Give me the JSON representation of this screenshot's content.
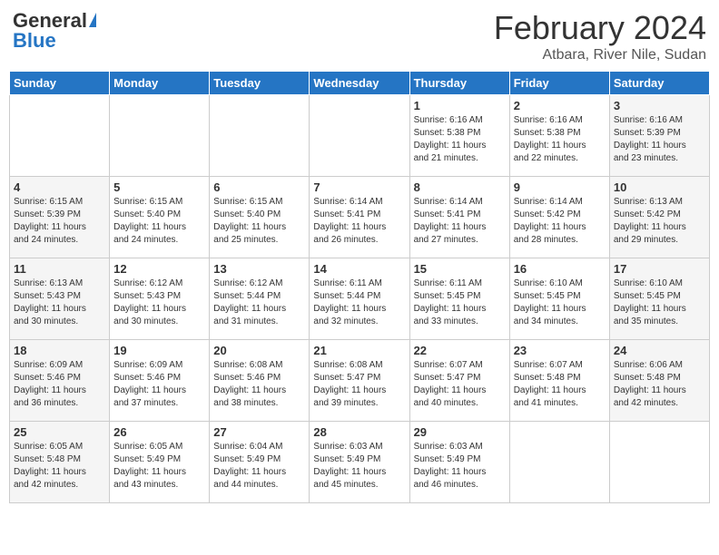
{
  "header": {
    "logo_general": "General",
    "logo_blue": "Blue",
    "month_title": "February 2024",
    "location": "Atbara, River Nile, Sudan"
  },
  "weekdays": [
    "Sunday",
    "Monday",
    "Tuesday",
    "Wednesday",
    "Thursday",
    "Friday",
    "Saturday"
  ],
  "weeks": [
    [
      {
        "day": "",
        "info": ""
      },
      {
        "day": "",
        "info": ""
      },
      {
        "day": "",
        "info": ""
      },
      {
        "day": "",
        "info": ""
      },
      {
        "day": "1",
        "info": "Sunrise: 6:16 AM\nSunset: 5:38 PM\nDaylight: 11 hours\nand 21 minutes."
      },
      {
        "day": "2",
        "info": "Sunrise: 6:16 AM\nSunset: 5:38 PM\nDaylight: 11 hours\nand 22 minutes."
      },
      {
        "day": "3",
        "info": "Sunrise: 6:16 AM\nSunset: 5:39 PM\nDaylight: 11 hours\nand 23 minutes."
      }
    ],
    [
      {
        "day": "4",
        "info": "Sunrise: 6:15 AM\nSunset: 5:39 PM\nDaylight: 11 hours\nand 24 minutes."
      },
      {
        "day": "5",
        "info": "Sunrise: 6:15 AM\nSunset: 5:40 PM\nDaylight: 11 hours\nand 24 minutes."
      },
      {
        "day": "6",
        "info": "Sunrise: 6:15 AM\nSunset: 5:40 PM\nDaylight: 11 hours\nand 25 minutes."
      },
      {
        "day": "7",
        "info": "Sunrise: 6:14 AM\nSunset: 5:41 PM\nDaylight: 11 hours\nand 26 minutes."
      },
      {
        "day": "8",
        "info": "Sunrise: 6:14 AM\nSunset: 5:41 PM\nDaylight: 11 hours\nand 27 minutes."
      },
      {
        "day": "9",
        "info": "Sunrise: 6:14 AM\nSunset: 5:42 PM\nDaylight: 11 hours\nand 28 minutes."
      },
      {
        "day": "10",
        "info": "Sunrise: 6:13 AM\nSunset: 5:42 PM\nDaylight: 11 hours\nand 29 minutes."
      }
    ],
    [
      {
        "day": "11",
        "info": "Sunrise: 6:13 AM\nSunset: 5:43 PM\nDaylight: 11 hours\nand 30 minutes."
      },
      {
        "day": "12",
        "info": "Sunrise: 6:12 AM\nSunset: 5:43 PM\nDaylight: 11 hours\nand 30 minutes."
      },
      {
        "day": "13",
        "info": "Sunrise: 6:12 AM\nSunset: 5:44 PM\nDaylight: 11 hours\nand 31 minutes."
      },
      {
        "day": "14",
        "info": "Sunrise: 6:11 AM\nSunset: 5:44 PM\nDaylight: 11 hours\nand 32 minutes."
      },
      {
        "day": "15",
        "info": "Sunrise: 6:11 AM\nSunset: 5:45 PM\nDaylight: 11 hours\nand 33 minutes."
      },
      {
        "day": "16",
        "info": "Sunrise: 6:10 AM\nSunset: 5:45 PM\nDaylight: 11 hours\nand 34 minutes."
      },
      {
        "day": "17",
        "info": "Sunrise: 6:10 AM\nSunset: 5:45 PM\nDaylight: 11 hours\nand 35 minutes."
      }
    ],
    [
      {
        "day": "18",
        "info": "Sunrise: 6:09 AM\nSunset: 5:46 PM\nDaylight: 11 hours\nand 36 minutes."
      },
      {
        "day": "19",
        "info": "Sunrise: 6:09 AM\nSunset: 5:46 PM\nDaylight: 11 hours\nand 37 minutes."
      },
      {
        "day": "20",
        "info": "Sunrise: 6:08 AM\nSunset: 5:46 PM\nDaylight: 11 hours\nand 38 minutes."
      },
      {
        "day": "21",
        "info": "Sunrise: 6:08 AM\nSunset: 5:47 PM\nDaylight: 11 hours\nand 39 minutes."
      },
      {
        "day": "22",
        "info": "Sunrise: 6:07 AM\nSunset: 5:47 PM\nDaylight: 11 hours\nand 40 minutes."
      },
      {
        "day": "23",
        "info": "Sunrise: 6:07 AM\nSunset: 5:48 PM\nDaylight: 11 hours\nand 41 minutes."
      },
      {
        "day": "24",
        "info": "Sunrise: 6:06 AM\nSunset: 5:48 PM\nDaylight: 11 hours\nand 42 minutes."
      }
    ],
    [
      {
        "day": "25",
        "info": "Sunrise: 6:05 AM\nSunset: 5:48 PM\nDaylight: 11 hours\nand 42 minutes."
      },
      {
        "day": "26",
        "info": "Sunrise: 6:05 AM\nSunset: 5:49 PM\nDaylight: 11 hours\nand 43 minutes."
      },
      {
        "day": "27",
        "info": "Sunrise: 6:04 AM\nSunset: 5:49 PM\nDaylight: 11 hours\nand 44 minutes."
      },
      {
        "day": "28",
        "info": "Sunrise: 6:03 AM\nSunset: 5:49 PM\nDaylight: 11 hours\nand 45 minutes."
      },
      {
        "day": "29",
        "info": "Sunrise: 6:03 AM\nSunset: 5:49 PM\nDaylight: 11 hours\nand 46 minutes."
      },
      {
        "day": "",
        "info": ""
      },
      {
        "day": "",
        "info": ""
      }
    ]
  ]
}
